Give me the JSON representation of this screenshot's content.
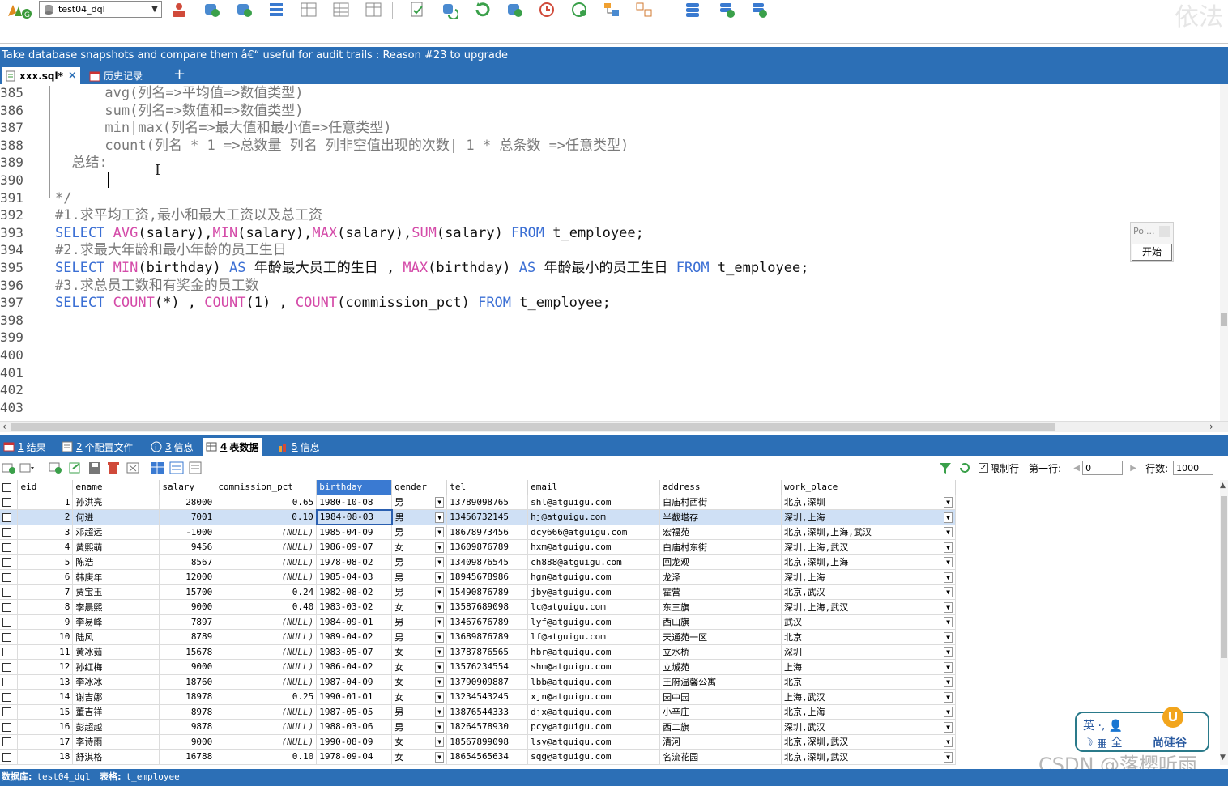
{
  "toolbar": {
    "database_selector": "test04_dql",
    "watermark": "依法"
  },
  "banner": {
    "text": "Take database snapshots and compare them â€“ useful for audit trails : Reason #23 to upgrade"
  },
  "tabs": [
    {
      "label": "xxx.sql*",
      "close": "×"
    },
    {
      "label": "历史记录"
    },
    {
      "label": "+"
    }
  ],
  "editor": {
    "lines": [
      {
        "n": "385",
        "t": "      avg(列名=>平均值=>数值类型)"
      },
      {
        "n": "386",
        "t": "      sum(列名=>数值和=>数值类型)"
      },
      {
        "n": "387",
        "t": "      min|max(列名=>最大值和最小值=>任意类型)"
      },
      {
        "n": "388",
        "t": "      count(列名 * 1 =>总数量 列名 列非空值出现的次数| 1 * 总条数 =>任意类型)"
      },
      {
        "n": "389",
        "t": "  总结:"
      },
      {
        "n": "390",
        "t": ""
      },
      {
        "n": "391",
        "t": "*/"
      },
      {
        "n": "392",
        "t": "#1.求平均工资,最小和最大工资以及总工资"
      },
      {
        "n": "393",
        "t": "SELECT AVG(salary),MIN(salary),MAX(salary),SUM(salary) FROM t_employee;"
      },
      {
        "n": "394",
        "t": "#2.求最大年龄和最小年龄的员工生日"
      },
      {
        "n": "395",
        "t": "SELECT MIN(birthday) AS 年龄最大员工的生日 , MAX(birthday) AS 年龄最小的员工生日 FROM t_employee;"
      },
      {
        "n": "396",
        "t": "#3.求总员工数和有奖金的员工数"
      },
      {
        "n": "397",
        "t": "SELECT COUNT(*) , COUNT(1) , COUNT(commission_pct) FROM t_employee;"
      },
      {
        "n": "398",
        "t": ""
      },
      {
        "n": "399",
        "t": ""
      },
      {
        "n": "400",
        "t": ""
      },
      {
        "n": "401",
        "t": ""
      },
      {
        "n": "402",
        "t": ""
      },
      {
        "n": "403",
        "t": ""
      }
    ],
    "popup_label": "Poi...",
    "popup_button": "开始"
  },
  "result_tabs": [
    {
      "num": "1",
      "label": "结果"
    },
    {
      "num": "2",
      "label": "个配置文件"
    },
    {
      "num": "3",
      "label": "信息"
    },
    {
      "num": "4",
      "label": "表数据"
    },
    {
      "num": "5",
      "label": "信息"
    }
  ],
  "grid_toolbar": {
    "limit_label": "限制行",
    "first_row_label": "第一行:",
    "first_row_value": "0",
    "rows_label": "行数:",
    "rows_value": "1000"
  },
  "grid": {
    "columns": [
      "eid",
      "ename",
      "salary",
      "commission_pct",
      "birthday",
      "gender",
      "tel",
      "email",
      "address",
      "work_place"
    ],
    "rows": [
      [
        "1",
        "孙洪亮",
        "28000",
        "0.65",
        "1980-10-08",
        "男",
        "13789098765",
        "shl@atguigu.com",
        "白庙村西街",
        "北京,深圳"
      ],
      [
        "2",
        "何进",
        "7001",
        "0.10",
        "1984-08-03",
        "男",
        "13456732145",
        "hj@atguigu.com",
        "半截塔存",
        "深圳,上海"
      ],
      [
        "3",
        "邓超远",
        "-1000",
        "(NULL)",
        "1985-04-09",
        "男",
        "18678973456",
        "dcy666@atguigu.com",
        "宏福苑",
        "北京,深圳,上海,武汉"
      ],
      [
        "4",
        "黄熙萌",
        "9456",
        "(NULL)",
        "1986-09-07",
        "女",
        "13609876789",
        "hxm@atguigu.com",
        "白庙村东街",
        "深圳,上海,武汉"
      ],
      [
        "5",
        "陈浩",
        "8567",
        "(NULL)",
        "1978-08-02",
        "男",
        "13409876545",
        "ch888@atguigu.com",
        "回龙观",
        "北京,深圳,上海"
      ],
      [
        "6",
        "韩庚年",
        "12000",
        "(NULL)",
        "1985-04-03",
        "男",
        "18945678986",
        "hgn@atguigu.com",
        "龙泽",
        "深圳,上海"
      ],
      [
        "7",
        "贾宝玉",
        "15700",
        "0.24",
        "1982-08-02",
        "男",
        "15490876789",
        "jby@atguigu.com",
        "霍营",
        "北京,武汉"
      ],
      [
        "8",
        "李晨熙",
        "9000",
        "0.40",
        "1983-03-02",
        "女",
        "13587689098",
        "lc@atguigu.com",
        "东三旗",
        "深圳,上海,武汉"
      ],
      [
        "9",
        "李易峰",
        "7897",
        "(NULL)",
        "1984-09-01",
        "男",
        "13467676789",
        "lyf@atguigu.com",
        "西山旗",
        "武汉"
      ],
      [
        "10",
        "陆风",
        "8789",
        "(NULL)",
        "1989-04-02",
        "男",
        "13689876789",
        "lf@atguigu.com",
        "天通苑一区",
        "北京"
      ],
      [
        "11",
        "黄冰茹",
        "15678",
        "(NULL)",
        "1983-05-07",
        "女",
        "13787876565",
        "hbr@atguigu.com",
        "立水桥",
        "深圳"
      ],
      [
        "12",
        "孙红梅",
        "9000",
        "(NULL)",
        "1986-04-02",
        "女",
        "13576234554",
        "shm@atguigu.com",
        "立城苑",
        "上海"
      ],
      [
        "13",
        "李冰冰",
        "18760",
        "(NULL)",
        "1987-04-09",
        "女",
        "13790909887",
        "lbb@atguigu.com",
        "王府温馨公寓",
        "北京"
      ],
      [
        "14",
        "谢吉娜",
        "18978",
        "0.25",
        "1990-01-01",
        "女",
        "13234543245",
        "xjn@atguigu.com",
        "园中园",
        "上海,武汉"
      ],
      [
        "15",
        "董吉祥",
        "8978",
        "(NULL)",
        "1987-05-05",
        "男",
        "13876544333",
        "djx@atguigu.com",
        "小辛庄",
        "北京,上海"
      ],
      [
        "16",
        "彭超越",
        "9878",
        "(NULL)",
        "1988-03-06",
        "男",
        "18264578930",
        "pcy@atguigu.com",
        "西二旗",
        "深圳,武汉"
      ],
      [
        "17",
        "李诗雨",
        "9000",
        "(NULL)",
        "1990-08-09",
        "女",
        "18567899098",
        "lsy@atguigu.com",
        "清河",
        "北京,深圳,武汉"
      ],
      [
        "18",
        "舒淇格",
        "16788",
        "0.10",
        "1978-09-04",
        "女",
        "18654565634",
        "sqg@atguigu.com",
        "名流花园",
        "北京,深圳,武汉"
      ]
    ]
  },
  "status": {
    "db_label": "数据库:",
    "db_value": "test04_dql",
    "table_label": "表格:",
    "table_value": "t_employee"
  },
  "overlay": {
    "csdn": "CSDN @落樱听雨",
    "ime_top": "英 ·, 👤",
    "ime_bottom": "☽ ▦ 全",
    "ime_brand": "尚硅谷",
    "ime_badge": "U"
  }
}
